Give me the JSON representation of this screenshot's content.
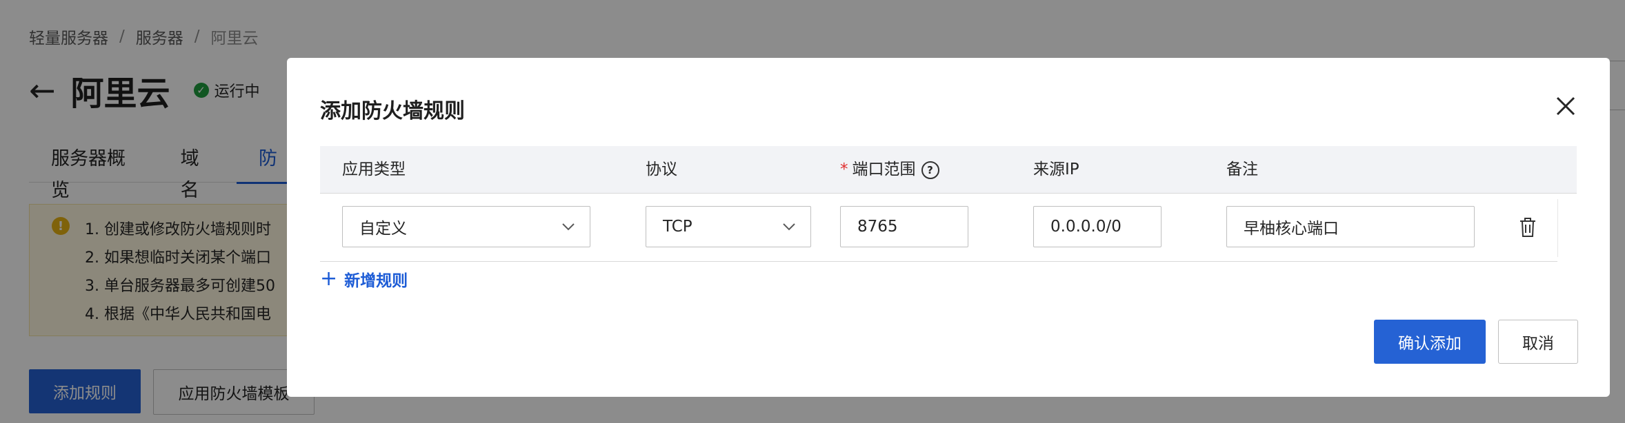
{
  "breadcrumb": [
    "轻量服务器",
    "服务器",
    "阿里云"
  ],
  "page": {
    "title": "阿里云",
    "status": "运行中"
  },
  "tabs": [
    "服务器概览",
    "域名",
    "防"
  ],
  "notice": {
    "items": [
      "1. 创建或修改防火墙规则时",
      "2. 如果想临时关闭某个端口",
      "3. 单台服务器最多可创建50",
      "4. 根据《中华人民共和国电"
    ]
  },
  "page_buttons": {
    "add_rule": "添加规则",
    "apply_template": "应用防火墙模板"
  },
  "modal": {
    "title": "添加防火墙规则",
    "columns": {
      "app_type": "应用类型",
      "protocol": "协议",
      "port_required_mark": "*",
      "port_range": "端口范围",
      "source_ip": "来源IP",
      "remark": "备注"
    },
    "row": {
      "app_type": "自定义",
      "protocol": "TCP",
      "port": "8765",
      "source_ip": "0.0.0.0/0",
      "remark": "早柚核心端口"
    },
    "add_rule_link": "新增规则",
    "confirm": "确认添加",
    "cancel": "取消"
  },
  "icons": [
    "back-arrow-icon",
    "check-circle-icon",
    "warning-icon",
    "close-icon",
    "question-icon",
    "chevron-down-icon",
    "trash-icon",
    "plus-icon"
  ],
  "colors": {
    "primary": "#2562d4",
    "status_green": "#1f9d3f",
    "required_red": "#e02f2f",
    "warning": "#e8b313"
  }
}
